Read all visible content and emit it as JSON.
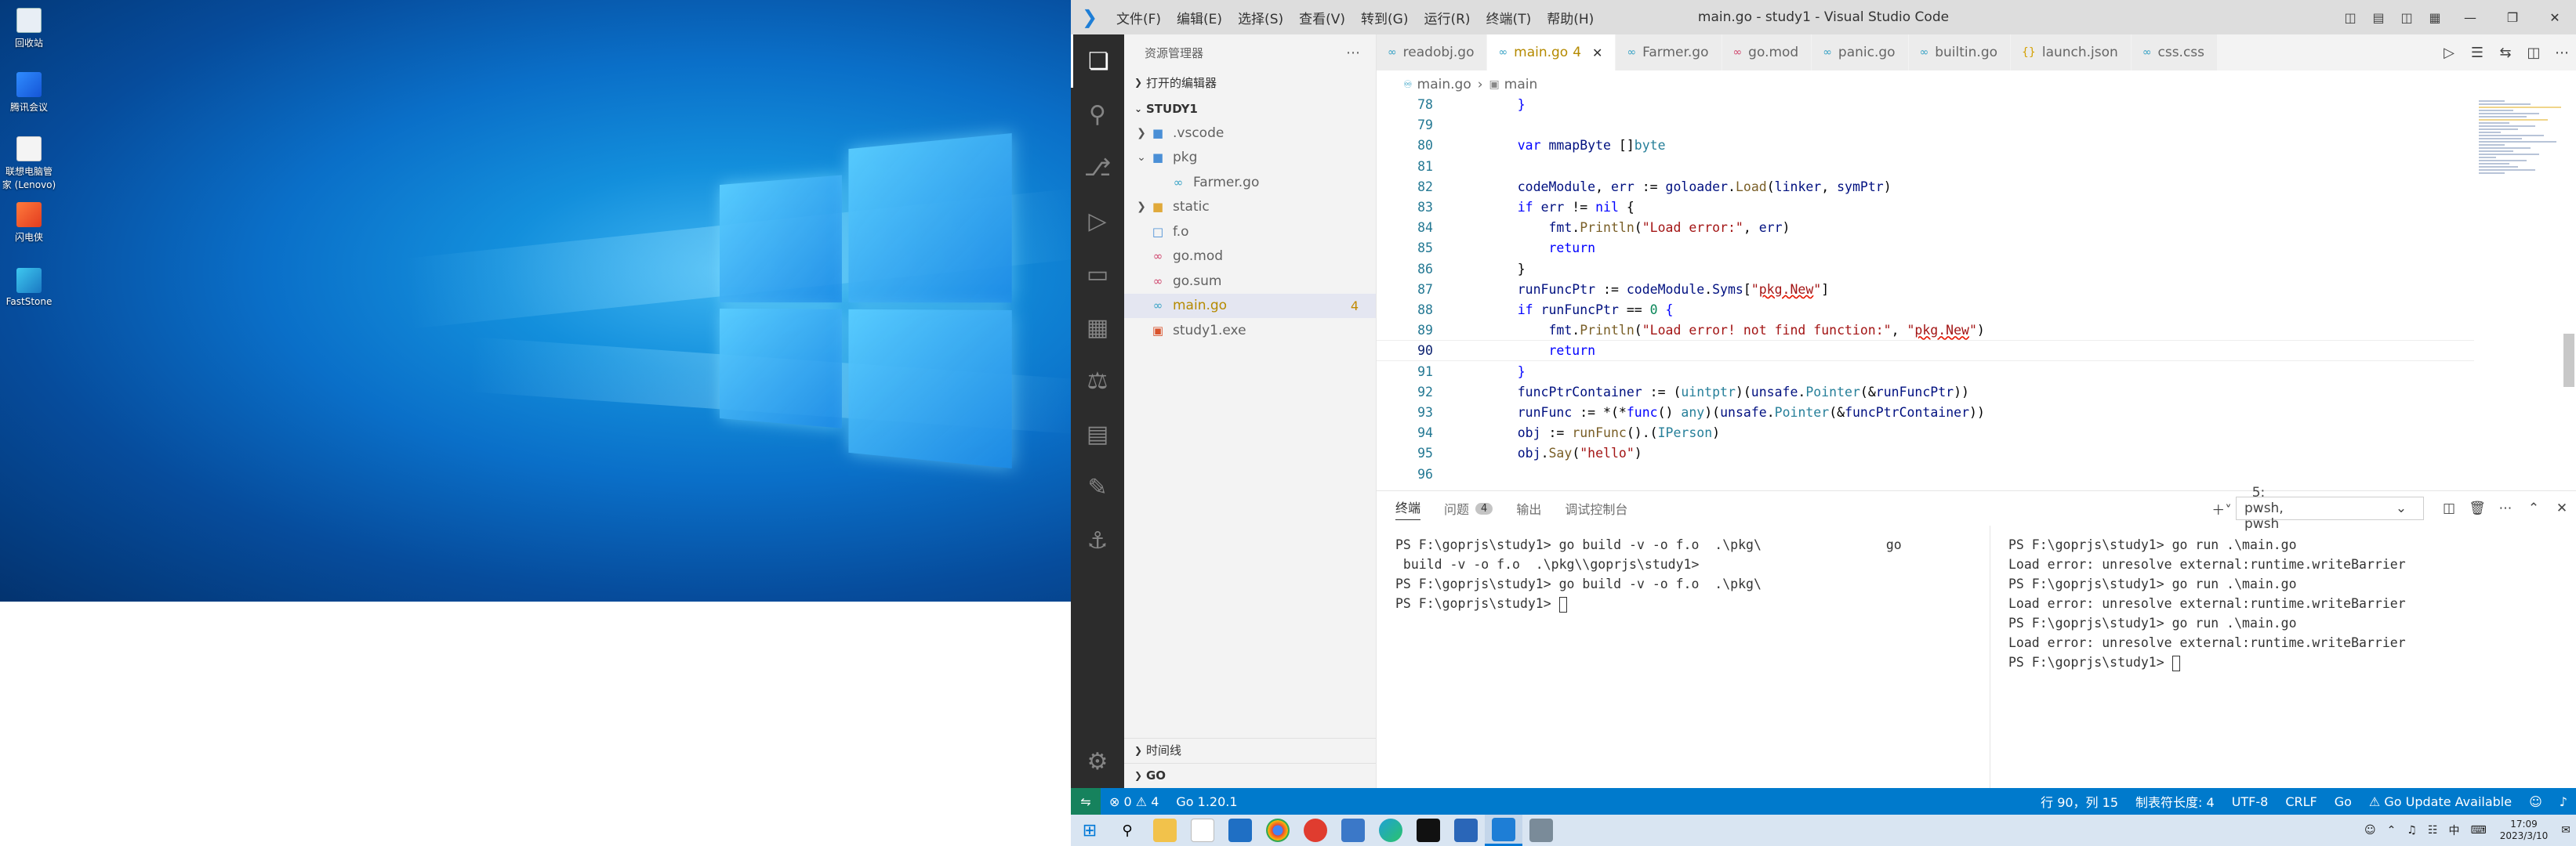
{
  "desktop": {
    "icons": [
      {
        "label": "回收站"
      },
      {
        "label": "腾讯会议"
      },
      {
        "label": "联想电脑管家 (Lenovo)"
      },
      {
        "label": "闪电侠"
      },
      {
        "label": "FastStone"
      }
    ]
  },
  "vscode": {
    "title": "main.go - study1 - Visual Studio Code",
    "menu": [
      "文件(F)",
      "编辑(E)",
      "选择(S)",
      "查看(V)",
      "转到(G)",
      "运行(R)",
      "终端(T)",
      "帮助(H)"
    ],
    "explorer": {
      "header": "资源管理器",
      "open_editors": "打开的编辑器",
      "root": "STUDY1",
      "tree": [
        {
          "label": ".vscode",
          "type": "folder",
          "expanded": false,
          "icon": "folder-icon",
          "color": "#4a8fd6"
        },
        {
          "label": "pkg",
          "type": "folder",
          "expanded": true,
          "icon": "folder-icon",
          "color": "#4a8fd6"
        },
        {
          "label": "Farmer.go",
          "type": "file",
          "icon": "go-file-icon",
          "color": "#3aa3c6"
        },
        {
          "label": "static",
          "type": "folder",
          "expanded": false,
          "icon": "folder-icon",
          "color": "#e0a93a"
        },
        {
          "label": "f.o",
          "type": "file",
          "icon": "file-icon",
          "color": "#4a8fd6"
        },
        {
          "label": "go.mod",
          "type": "file",
          "icon": "gomod-icon",
          "color": "#d0486f"
        },
        {
          "label": "go.sum",
          "type": "file",
          "icon": "gomod-icon",
          "color": "#d0486f"
        },
        {
          "label": "main.go",
          "type": "file",
          "icon": "go-file-icon",
          "color": "#3aa3c6",
          "badge": "4"
        },
        {
          "label": "study1.exe",
          "type": "file",
          "icon": "exe-icon",
          "color": "#d9532c"
        }
      ],
      "timeline": "时间线",
      "go_section": "GO"
    },
    "tabs": [
      {
        "label": "readobj.go",
        "icon_color": "#3aa3c6"
      },
      {
        "label": "main.go",
        "icon_color": "#3aa3c6",
        "active": true,
        "badge": "4"
      },
      {
        "label": "Farmer.go",
        "icon_color": "#3aa3c6"
      },
      {
        "label": "go.mod",
        "icon_color": "#d0486f"
      },
      {
        "label": "panic.go",
        "icon_color": "#3aa3c6"
      },
      {
        "label": "builtin.go",
        "icon_color": "#3aa3c6"
      },
      {
        "label": "launch.json",
        "icon_color": "#d4a000"
      },
      {
        "label": "css.css",
        "icon_color": "#3aa3c6"
      }
    ],
    "breadcrumb": {
      "file": "main.go",
      "symbol": "main"
    },
    "code_lines": [
      {
        "n": "78",
        "html": "    <span class='kw'>}</span>"
      },
      {
        "n": "79",
        "html": ""
      },
      {
        "n": "80",
        "html": "    <span class='kw'>var</span> <span class='var'>mmapByte</span> []<span class='ty'>byte</span>"
      },
      {
        "n": "81",
        "html": ""
      },
      {
        "n": "82",
        "html": "    <span class='var'>codeModule</span>, <span class='var'>err</span> := <span class='var'>goloader</span>.<span class='fn'>Load</span>(<span class='var'>linker</span>, <span class='var'>symPtr</span>)"
      },
      {
        "n": "83",
        "html": "    <span class='kw'>if</span> <span class='var'>err</span> != <span class='kw'>nil</span> {"
      },
      {
        "n": "84",
        "html": "        <span class='var'>fmt</span>.<span class='fn'>Println</span>(<span class='str'>\"Load error:\"</span>, <span class='var'>err</span>)"
      },
      {
        "n": "85",
        "html": "        <span class='kw'>return</span>"
      },
      {
        "n": "86",
        "html": "    }"
      },
      {
        "n": "87",
        "html": "    <span class='var'>runFuncPtr</span> := <span class='var'>codeModule</span>.<span class='var'>Syms</span>[<span class='str'>\"<span class='squig'>pkg.New</span>\"</span>]"
      },
      {
        "n": "88",
        "html": "    <span class='kw'>if</span> <span class='var'>runFuncPtr</span> == <span class='num'>0</span> <span class='kw'>{</span>"
      },
      {
        "n": "89",
        "html": "        <span class='var'>fmt</span>.<span class='fn'>Println</span>(<span class='str'>\"Load error! not find function:\"</span>, <span class='str'>\"<span class='squig'>pkg.New</span>\"</span>)"
      },
      {
        "n": "90",
        "html": "        <span class='kw'>return</span>",
        "current": true
      },
      {
        "n": "91",
        "html": "    <span class='kw'>}</span>"
      },
      {
        "n": "92",
        "html": "    <span class='var'>funcPtrContainer</span> := (<span class='ty'>uintptr</span>)(<span class='var'>unsafe</span>.<span class='ty'>Pointer</span>(&amp;<span class='var'>runFuncPtr</span>))"
      },
      {
        "n": "93",
        "html": "    <span class='var'>runFunc</span> := *(*<span class='kw'>func</span>() <span class='ty'>any</span>)(<span class='var'>unsafe</span>.<span class='ty'>Pointer</span>(&amp;<span class='var'>funcPtrContainer</span>))"
      },
      {
        "n": "94",
        "html": "    <span class='var'>obj</span> := <span class='fn'>runFunc</span>().(<span class='ty'>IPerson</span>)"
      },
      {
        "n": "95",
        "html": "    <span class='var'>obj</span>.<span class='fn'>Say</span>(<span class='str'>\"hello\"</span>)"
      },
      {
        "n": "96",
        "html": ""
      }
    ],
    "panel": {
      "tabs": {
        "terminal": "终端",
        "problems": "问题",
        "problems_count": "4",
        "output": "输出",
        "debug_console": "调试控制台"
      },
      "terminal_select": "5: pwsh, pwsh",
      "left_terminal": "PS F:\\goprjs\\study1> go build -v -o f.o  .\\pkg\\                go\n build -v -o f.o  .\\pkg\\\\goprjs\\study1>\nPS F:\\goprjs\\study1> go build -v -o f.o  .\\pkg\\\nPS F:\\goprjs\\study1> ",
      "right_terminal": "PS F:\\goprjs\\study1> go run .\\main.go\nLoad error: unresolve external:runtime.writeBarrier\nPS F:\\goprjs\\study1> go run .\\main.go\nLoad error: unresolve external:runtime.writeBarrier\nPS F:\\goprjs\\study1> go run .\\main.go\nLoad error: unresolve external:runtime.writeBarrier\nPS F:\\goprjs\\study1> "
    },
    "statusbar": {
      "errors": "0",
      "warnings": "4",
      "go_version": "Go 1.20.1",
      "position": "行 90，列 15",
      "tab_size": "制表符长度: 4",
      "encoding": "UTF-8",
      "eol": "CRLF",
      "language": "Go",
      "update": "Go Update Available"
    }
  },
  "taskbar": {
    "time": "17:09",
    "date": "2023/3/10",
    "ime": "中"
  },
  "colors": {
    "accent": "#007acc",
    "activitybar": "#2c2c2c",
    "remote": "#16825d"
  }
}
